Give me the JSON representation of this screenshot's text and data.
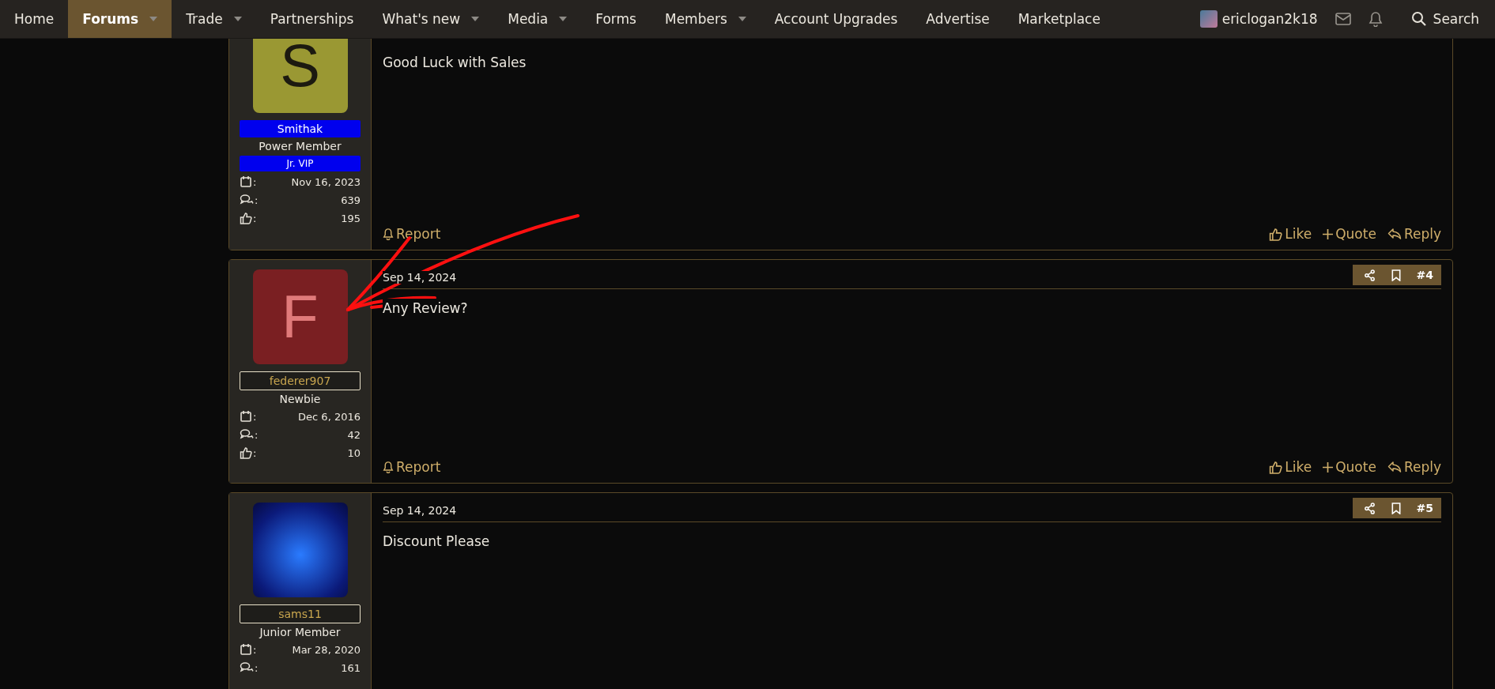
{
  "nav": {
    "items": [
      {
        "label": "Home",
        "has_menu": false,
        "selected": false
      },
      {
        "label": "Forums",
        "has_menu": true,
        "selected": true
      },
      {
        "label": "Trade",
        "has_menu": true,
        "selected": false
      },
      {
        "label": "Partnerships",
        "has_menu": false,
        "selected": false
      },
      {
        "label": "What's new",
        "has_menu": true,
        "selected": false
      },
      {
        "label": "Media",
        "has_menu": true,
        "selected": false
      },
      {
        "label": "Forms",
        "has_menu": false,
        "selected": false
      },
      {
        "label": "Members",
        "has_menu": true,
        "selected": false
      },
      {
        "label": "Account Upgrades",
        "has_menu": false,
        "selected": false
      },
      {
        "label": "Advertise",
        "has_menu": false,
        "selected": false
      },
      {
        "label": "Marketplace",
        "has_menu": false,
        "selected": false
      }
    ],
    "user": "ericlogan2k18",
    "search": "Search"
  },
  "posts": [
    {
      "avatar": {
        "kind": "letter",
        "letter": "S",
        "color": "#9a9833"
      },
      "username": "Smithak",
      "username_highlighted": true,
      "rank": "Power Member",
      "banner": "Jr. VIP",
      "stats": [
        {
          "kind": "joined",
          "sep": ":",
          "value": "Nov 16, 2023"
        },
        {
          "kind": "messages",
          "sep": ":",
          "value": "639"
        },
        {
          "kind": "reactions",
          "sep": ":",
          "value": "195"
        }
      ],
      "body": "Good Luck with Sales",
      "actions": {
        "report": "Report",
        "like": "Like",
        "quote": "Quote",
        "reply": "Reply"
      }
    },
    {
      "date": "Sep 14, 2024",
      "number": "#4",
      "avatar": {
        "kind": "letter",
        "letter": "F",
        "color": "#7a1f22"
      },
      "username": "federer907",
      "username_highlighted": false,
      "rank": "Newbie",
      "stats": [
        {
          "kind": "joined",
          "sep": ":",
          "value": "Dec 6, 2016"
        },
        {
          "kind": "messages",
          "sep": ":",
          "value": "42"
        },
        {
          "kind": "reactions",
          "sep": ":",
          "value": "10"
        }
      ],
      "body": "Any Review?",
      "actions": {
        "report": "Report",
        "like": "Like",
        "quote": "Quote",
        "reply": "Reply"
      }
    },
    {
      "date": "Sep 14, 2024",
      "number": "#5",
      "avatar": {
        "kind": "photo"
      },
      "username": "sams11",
      "username_highlighted": false,
      "rank": "Junior Member",
      "stats": [
        {
          "kind": "joined",
          "sep": ":",
          "value": "Mar 28, 2020"
        },
        {
          "kind": "messages",
          "sep": ":",
          "value": "161"
        }
      ],
      "body": "Discount Please"
    }
  ]
}
